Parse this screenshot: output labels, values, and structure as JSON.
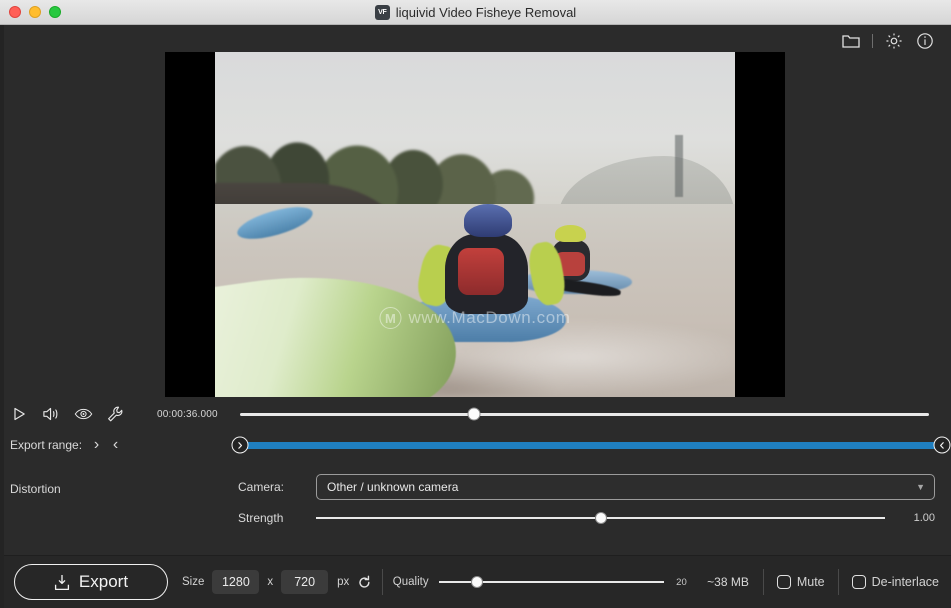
{
  "window": {
    "title": "liquivid Video Fisheye Removal",
    "app_icon_text": "VF",
    "traffic_lights": [
      "close",
      "minimize",
      "maximize"
    ]
  },
  "toolbar": {
    "folder_icon": "folder-icon",
    "settings_icon": "gear-icon",
    "info_icon": "info-icon"
  },
  "video": {
    "watermark_logo": "M",
    "watermark_text": "www.MacDown.com"
  },
  "transport": {
    "play_icon": "play-icon",
    "volume_icon": "speaker-icon",
    "preview_icon": "eye-icon",
    "tools_icon": "wrench-icon",
    "timecode": "00:00:36.000",
    "seek_percent": 34
  },
  "export_range": {
    "label": "Export range:",
    "arrow_in": "›",
    "arrow_out": "‹",
    "left_handle_icon": "›",
    "right_handle_icon": "‹",
    "start_percent": 0,
    "end_percent": 100,
    "bar_color": "#1f7fc0"
  },
  "distortion": {
    "title": "Distortion",
    "camera_label": "Camera:",
    "camera_value": "Other / unknown camera",
    "camera_options": [
      "Other / unknown camera"
    ],
    "strength_label": "Strength",
    "strength_value": "1.00",
    "strength_percent": 50
  },
  "bottom": {
    "export_label": "Export",
    "export_icon": "download-icon",
    "size_label": "Size",
    "width_value": "1280",
    "width_placeholder": "1280",
    "x_label": "x",
    "height_value": "720",
    "height_placeholder": "720",
    "unit_label": "px",
    "reset_icon": "reset-icon",
    "quality_label": "Quality",
    "quality_value": "20",
    "quality_percent": 20,
    "file_size": "~38 MB",
    "mute_label": "Mute",
    "mute_checked": false,
    "deinterlace_label": "De-interlace",
    "deinterlace_checked": false
  }
}
